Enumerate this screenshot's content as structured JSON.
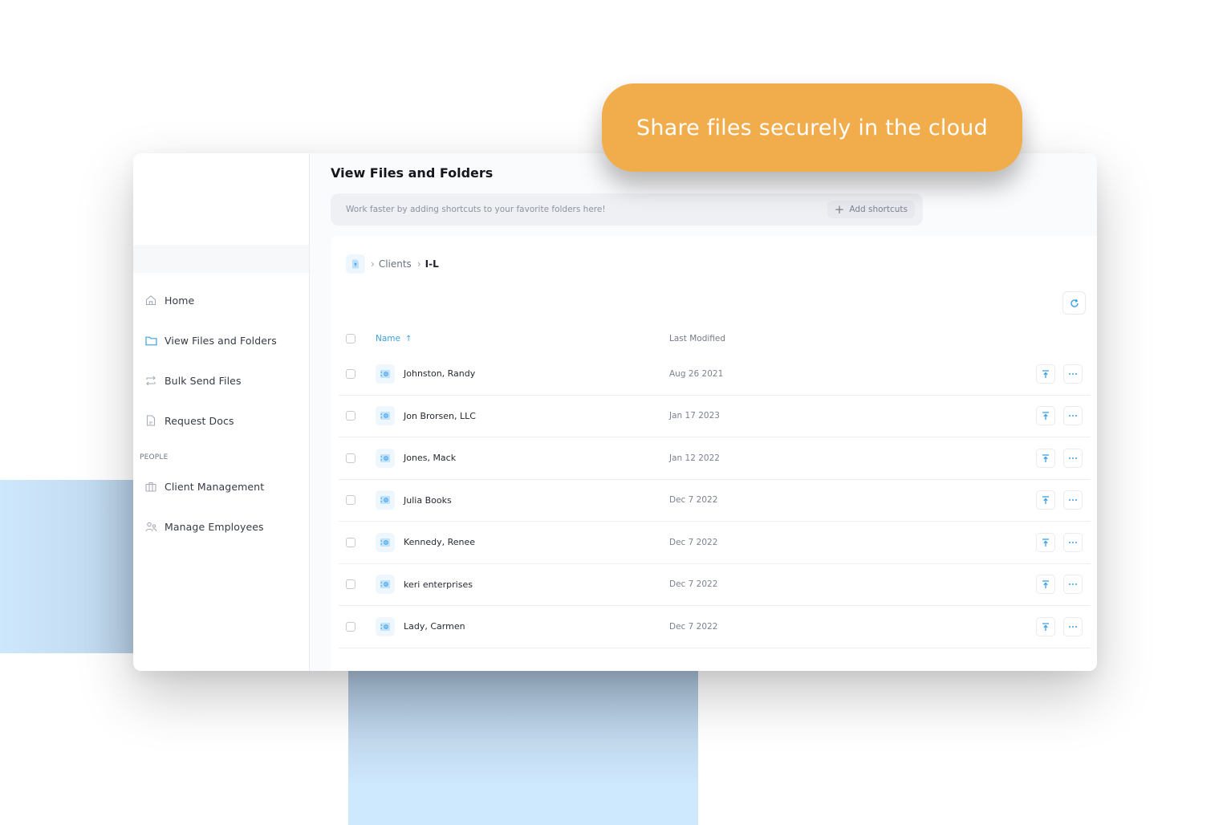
{
  "banner": {
    "text": "Share files securely in the cloud",
    "color": "#f1ac4c"
  },
  "sidebar": {
    "items": [
      {
        "label": "Home",
        "icon": "home-icon",
        "active": false
      },
      {
        "label": "View Files and Folders",
        "icon": "folder-icon",
        "active": true
      },
      {
        "label": "Bulk Send Files",
        "icon": "transfer-icon",
        "active": false
      },
      {
        "label": "Request Docs",
        "icon": "document-icon",
        "active": false
      }
    ],
    "section_label": "PEOPLE",
    "people_items": [
      {
        "label": "Client Management",
        "icon": "briefcase-icon"
      },
      {
        "label": "Manage Employees",
        "icon": "users-icon"
      }
    ]
  },
  "header": {
    "title": "View Files and Folders",
    "shortcut_hint": "Work faster by adding shortcuts to your favorite folders here!",
    "add_shortcuts_label": "Add shortcuts"
  },
  "breadcrumb": {
    "items": [
      "Clients"
    ],
    "current": "I-L"
  },
  "table": {
    "columns": {
      "name": "Name",
      "modified": "Last Modified"
    },
    "sort": {
      "column": "name",
      "direction": "ascending"
    },
    "rows": [
      {
        "name": "Johnston, Randy",
        "modified": "Aug 26 2021"
      },
      {
        "name": "Jon Brorsen, LLC",
        "modified": "Jan 17 2023"
      },
      {
        "name": "Jones, Mack",
        "modified": "Jan 12 2022"
      },
      {
        "name": "Julia Books",
        "modified": "Dec 7 2022"
      },
      {
        "name": "Kennedy, Renee",
        "modified": "Dec 7 2022"
      },
      {
        "name": "keri enterprises",
        "modified": "Dec 7 2022"
      },
      {
        "name": "Lady, Carmen",
        "modified": "Dec 7 2022"
      }
    ]
  },
  "colors": {
    "accent": "#3aa0e6",
    "banner": "#f1ac4c"
  }
}
